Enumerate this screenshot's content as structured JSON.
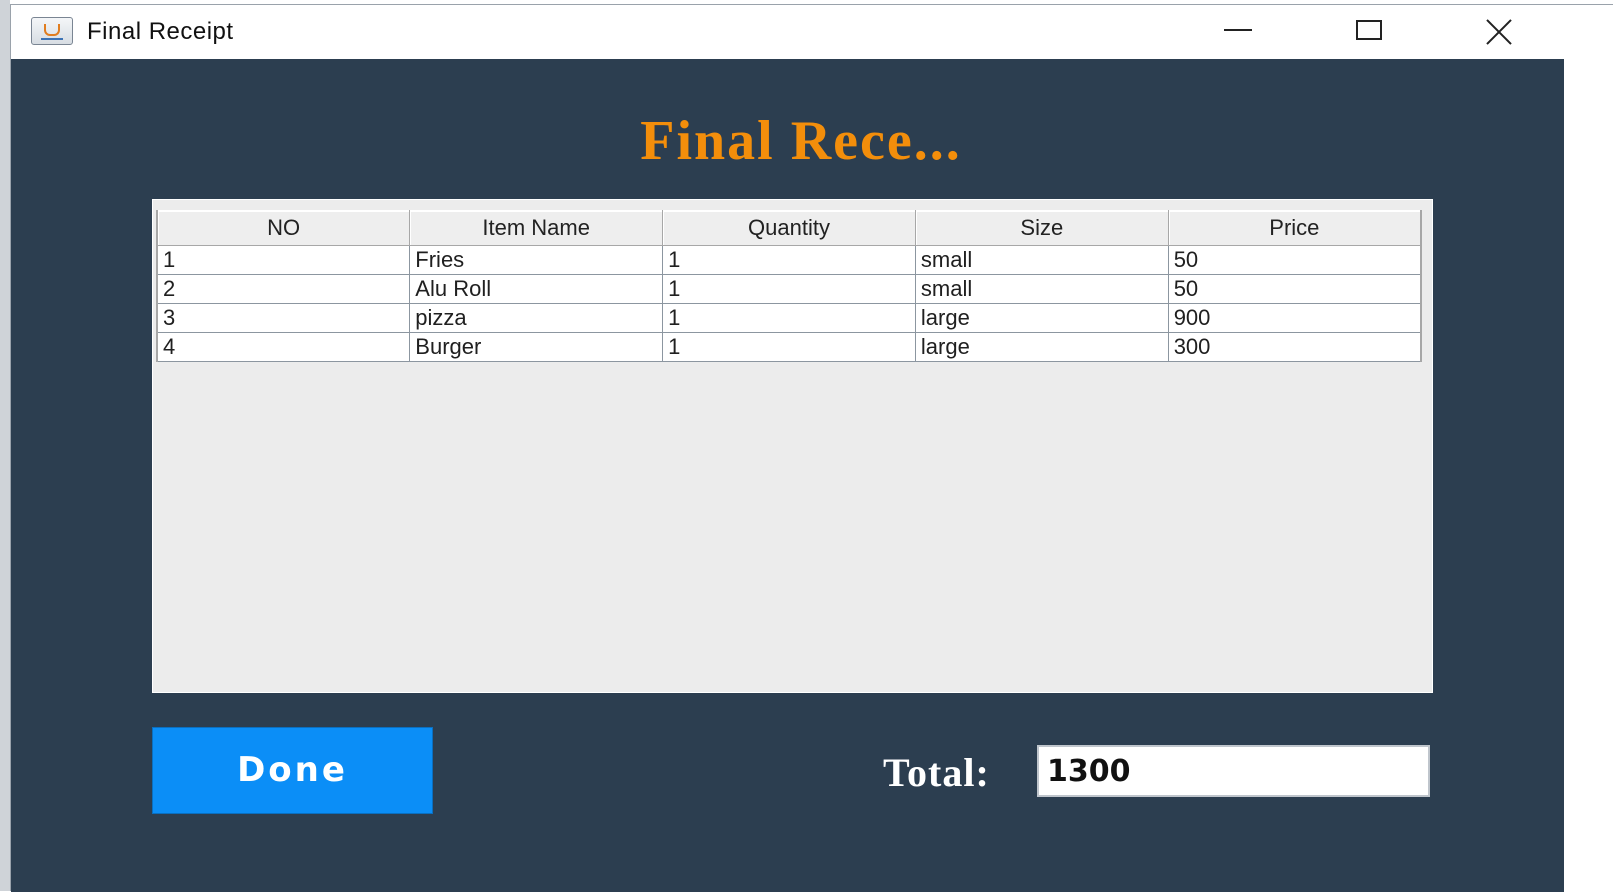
{
  "window": {
    "title": "Final Receipt",
    "icon": "java-cup-icon"
  },
  "titlebar_buttons": {
    "minimize": "minimize-icon",
    "maximize": "maximize-icon",
    "close": "close-icon"
  },
  "heading": "Final Rece...",
  "table": {
    "columns": [
      "NO",
      "Item Name",
      "Quantity",
      "Size",
      "Price"
    ],
    "rows": [
      [
        "1",
        "Fries",
        "1",
        "small",
        "50"
      ],
      [
        "2",
        "Alu Roll",
        "1",
        "small",
        "50"
      ],
      [
        "3",
        "pizza",
        "1",
        "large",
        "900"
      ],
      [
        "4",
        "Burger",
        "1",
        "large",
        "300"
      ]
    ]
  },
  "footer": {
    "done_label": "Done",
    "total_label": "Total:",
    "total_value": "1300"
  },
  "colors": {
    "background": "#2c3e50",
    "heading": "#f38e0b",
    "done_button": "#0b8ef7"
  }
}
